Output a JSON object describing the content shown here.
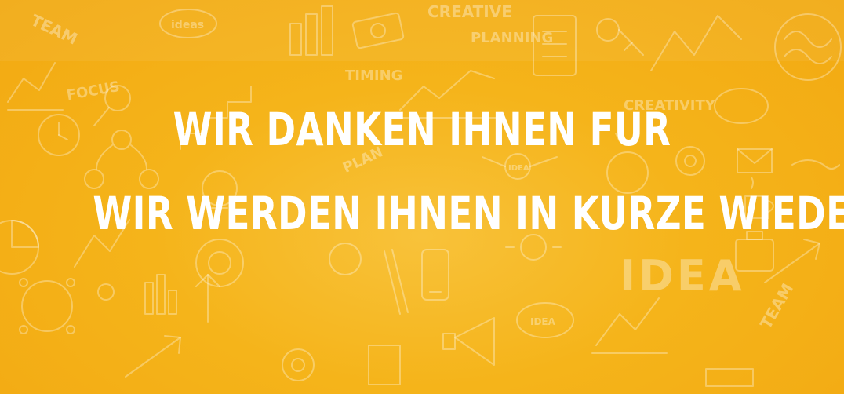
{
  "banner": {
    "line_1": "WIR DANKEN IHNEN FUR",
    "line_2": "WIR WERDEN IHNEN IN KURZE WIEDER",
    "background_color": "#f5b41a",
    "text_color": "#ffffff"
  },
  "doodle_words": {
    "team": "TEAM",
    "ideas": "ideas",
    "creative": "CREATIVE",
    "planning": "PLANNING",
    "timing": "TIMING",
    "focus": "FOCUS",
    "creativity": "CREATIVITY",
    "plan": "PLAN",
    "idea_small": "IDEA",
    "idea_big": "IDEA",
    "idea_cloud": "IDEA",
    "team_right": "TEAM"
  },
  "icons": [
    "bar-chart-icon",
    "money-icon",
    "checklist-icon",
    "key-icon",
    "brain-icon",
    "stairs-icon",
    "magnifier-icon",
    "clock-icon",
    "lightbulb-icon",
    "at-sign-icon",
    "envelope-icon",
    "coffee-icon",
    "pencil-icon",
    "phone-icon",
    "megaphone-icon",
    "gear-icon",
    "briefcase-icon",
    "arrow-icon",
    "people-network-icon",
    "pie-chart-icon"
  ]
}
